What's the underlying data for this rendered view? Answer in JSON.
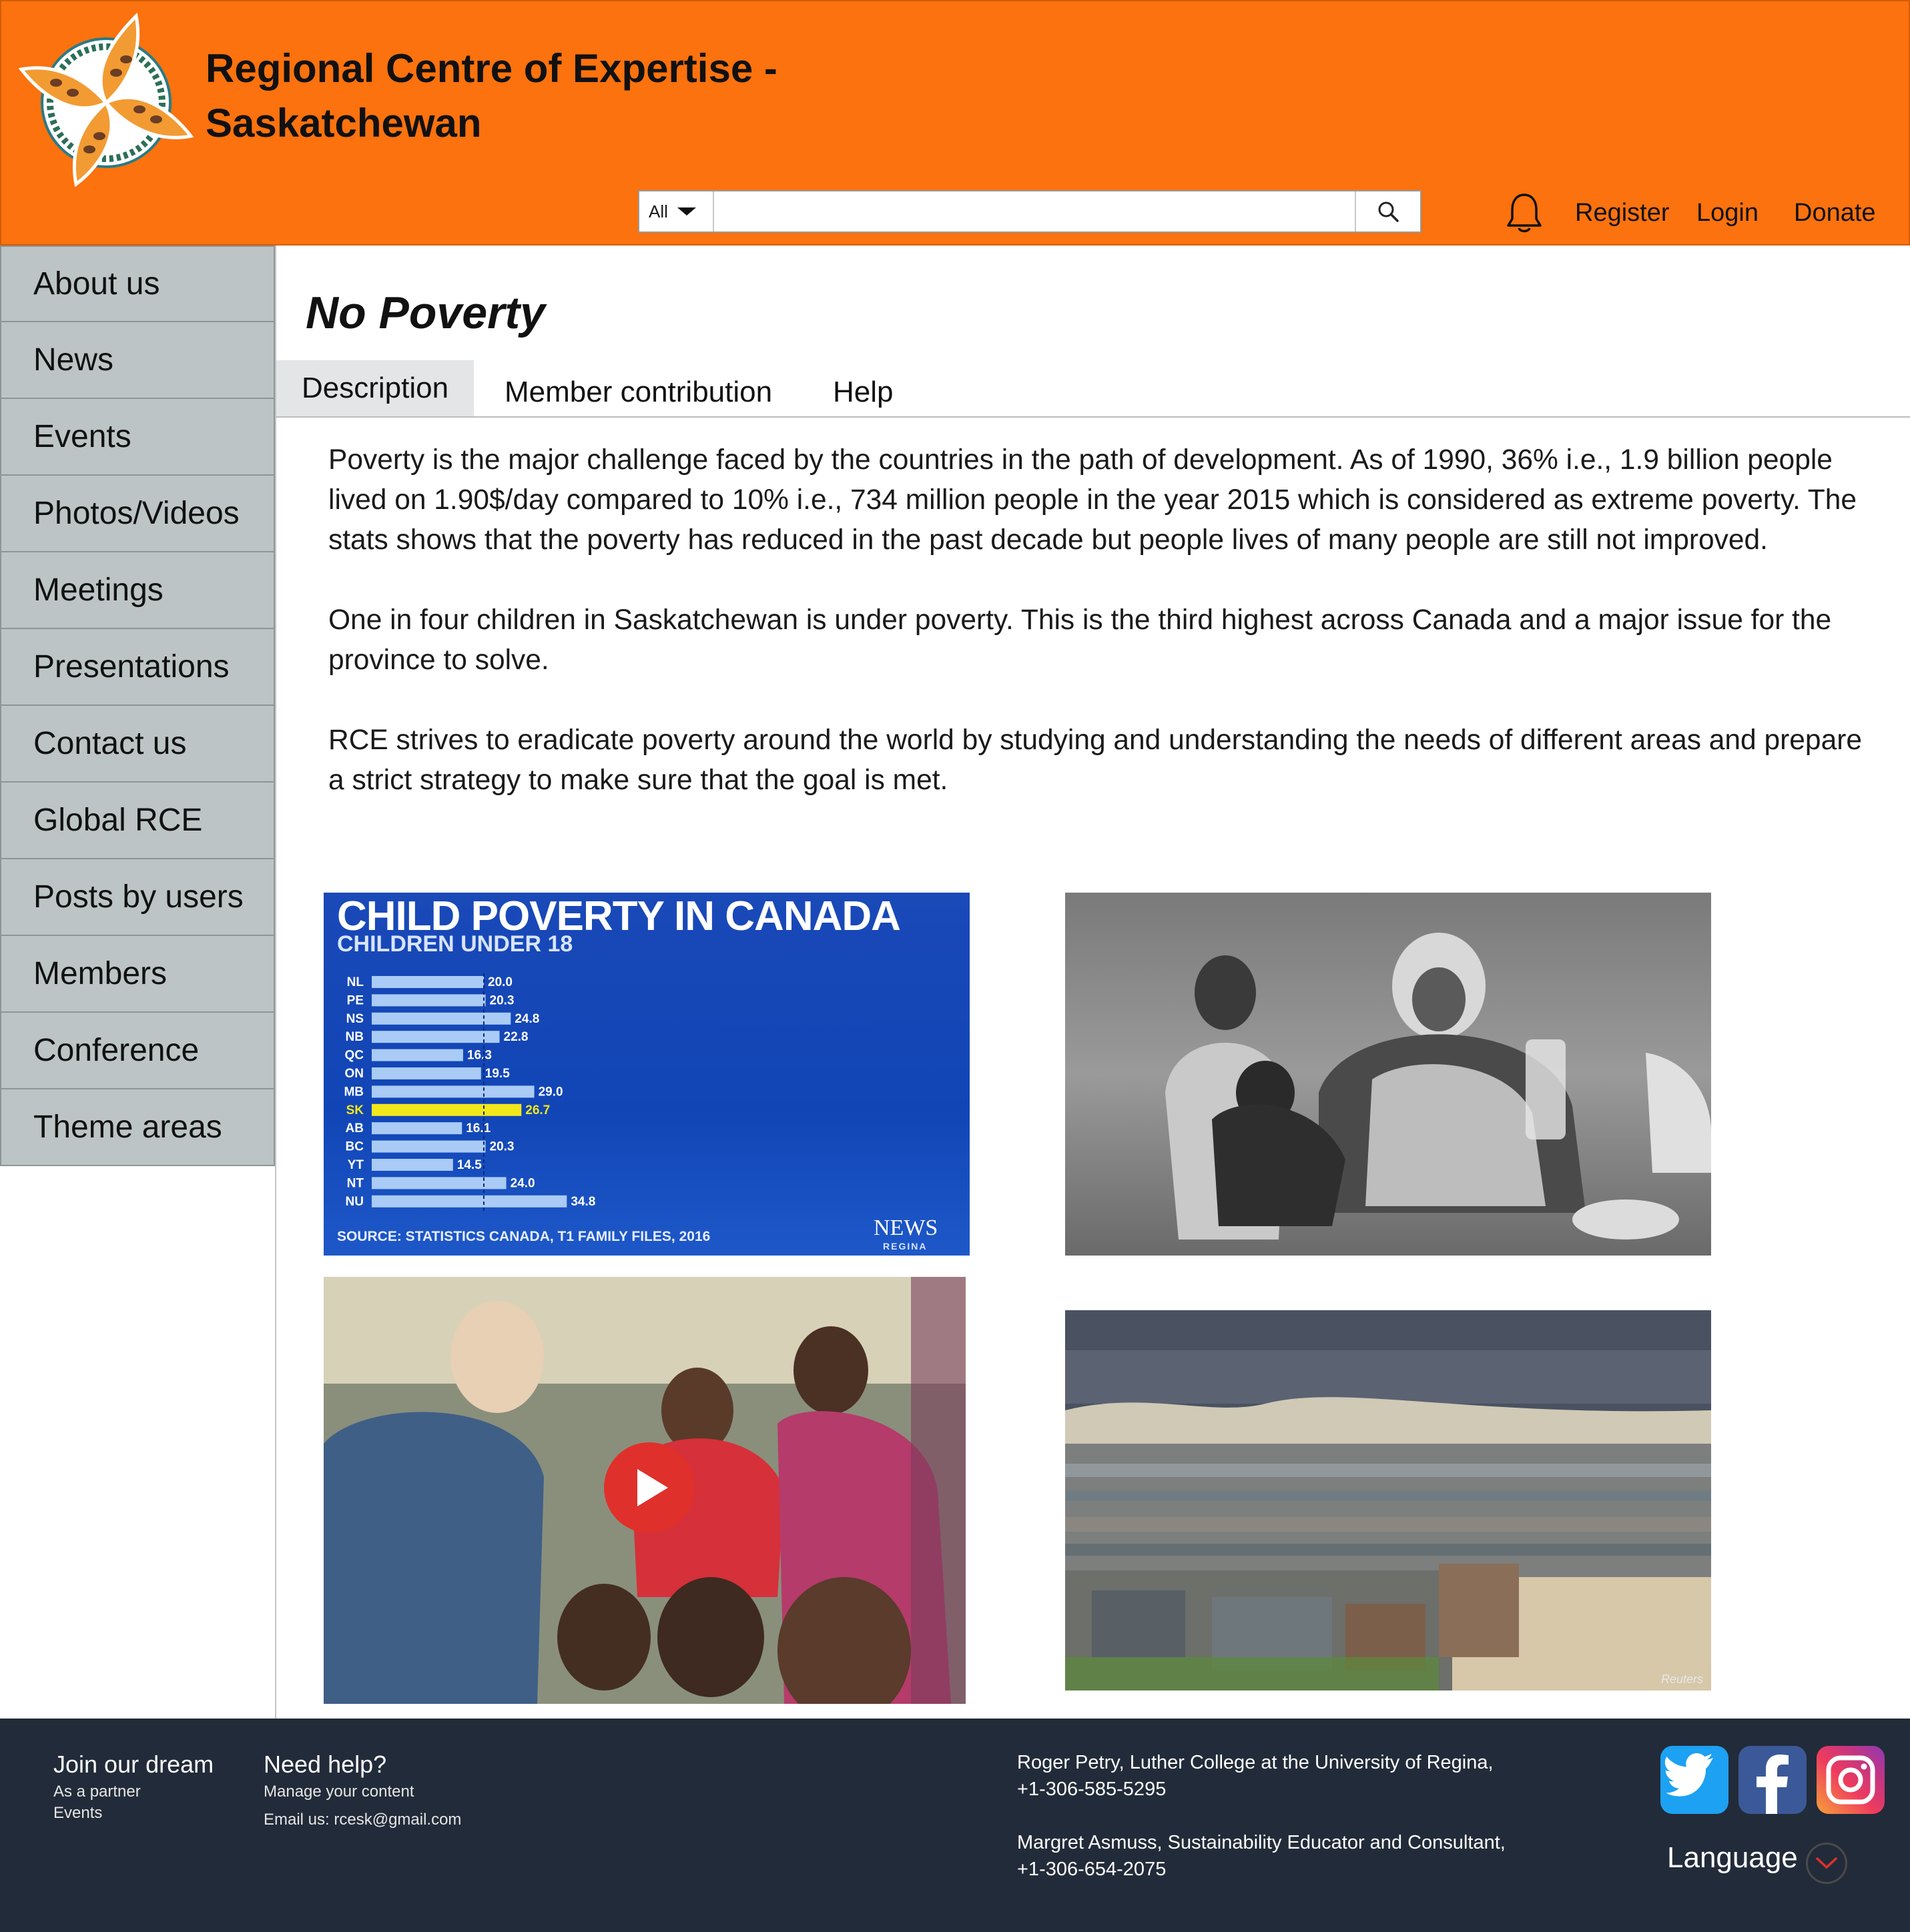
{
  "header": {
    "title_line1": "Regional Centre of Expertise -",
    "title_line2": "Saskatchewan",
    "search_scope": "All",
    "search_placeholder": "",
    "links": {
      "register": "Register",
      "login": "Login",
      "donate": "Donate"
    },
    "icons": {
      "logo": "rce-logo",
      "bell": "bell-icon",
      "search": "search-icon"
    },
    "colors": {
      "header_bg": "#fb720e",
      "sidebar_bg": "#bcc4c5",
      "footer_bg": "#222b39"
    }
  },
  "sidebar": {
    "items": [
      {
        "label": "About us"
      },
      {
        "label": "News"
      },
      {
        "label": "Events"
      },
      {
        "label": "Photos/Videos"
      },
      {
        "label": "Meetings"
      },
      {
        "label": "Presentations"
      },
      {
        "label": "Contact us"
      },
      {
        "label": "Global RCE"
      },
      {
        "label": "Posts by users"
      },
      {
        "label": "Members"
      },
      {
        "label": "Conference"
      },
      {
        "label": "Theme areas"
      }
    ]
  },
  "main": {
    "title": "No Poverty",
    "tabs": [
      {
        "label": "Description",
        "active": true
      },
      {
        "label": "Member contribution"
      },
      {
        "label": "Help"
      }
    ],
    "paragraphs": [
      "Poverty is the major challenge faced by the countries in the path of development. As of 1990, 36% i.e., 1.9 billion people lived on 1.90$/day compared to 10% i.e., 734 million people in the year 2015 which is considered as extreme poverty. The stats shows that the poverty has reduced in the past decade but people lives of many people are still not improved.",
      "One in four children in Saskatchewan is under poverty. This is the third highest across Canada and a major issue for the province to solve.",
      "RCE strives to eradicate poverty around the world by studying and understanding the needs of different areas and prepare a strict strategy to make sure that the goal is met."
    ],
    "image_chart": {
      "title": "CHILD POVERTY IN CANADA",
      "subtitle": "CHILDREN UNDER 18",
      "source": "SOURCE: STATISTICS CANADA, T1 FAMILY FILES, 2016",
      "logo": "NEWS",
      "logo_sub": "REGINA"
    },
    "image_slum_credit": "Reuters",
    "video": {
      "play_icon": "play-icon"
    }
  },
  "chart_data": {
    "type": "bar",
    "title": "CHILD POVERTY IN CANADA",
    "subtitle": "CHILDREN UNDER 18",
    "categories": [
      "NL",
      "PE",
      "NS",
      "NB",
      "QC",
      "ON",
      "MB",
      "SK",
      "AB",
      "BC",
      "YT",
      "NT",
      "NU"
    ],
    "values": [
      20.0,
      20.3,
      24.8,
      22.8,
      16.3,
      19.5,
      29.0,
      26.7,
      16.1,
      20.3,
      14.5,
      24.0,
      34.8
    ],
    "value_labels": [
      "20.0",
      "20.3",
      "24.8",
      "22.8",
      "16.3",
      "19.5",
      "29.0",
      "26.7",
      "16.1",
      "20.3",
      "14.5",
      "24.0",
      "34.8"
    ],
    "highlight": "SK",
    "orientation": "horizontal",
    "reference_line": 20.0,
    "xlim": [
      0,
      40
    ],
    "colors": {
      "bar": "#a9cbf5",
      "highlight": "#f3e81a",
      "background": "#1547b8"
    }
  },
  "footer": {
    "join": {
      "heading": "Join our dream",
      "items": [
        "As a partner",
        "Events"
      ]
    },
    "help": {
      "heading": "Need help?",
      "items": [
        "Manage your content",
        "Email us: rcesk@gmail.com"
      ]
    },
    "contacts": [
      {
        "line1": "Roger Petry, Luther College at the University of Regina,",
        "line2": "+1-306-585-5295"
      },
      {
        "line1": "Margret Asmuss, Sustainability Educator and Consultant,",
        "line2": "+1-306-654-2075"
      }
    ],
    "social": [
      "twitter-icon",
      "facebook-icon",
      "instagram-icon"
    ],
    "language": "Language"
  }
}
